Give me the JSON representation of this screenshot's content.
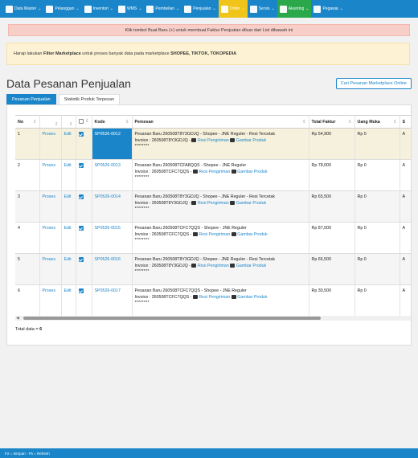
{
  "nav": [
    {
      "label": "Data Master",
      "icon": "list-icon"
    },
    {
      "label": "Pelanggan",
      "icon": "users-icon"
    },
    {
      "label": "Inventori",
      "icon": "truck-icon"
    },
    {
      "label": "WMS",
      "icon": "building-icon"
    },
    {
      "label": "Pembelian",
      "icon": "cart-icon"
    },
    {
      "label": "Penjualan",
      "icon": "document-icon"
    },
    {
      "label": "Order",
      "icon": "fork-knife-icon"
    },
    {
      "label": "Servis",
      "icon": "gears-icon"
    },
    {
      "label": "Akunting",
      "icon": "money-icon"
    },
    {
      "label": "Pegawai",
      "icon": "id-card-icon"
    }
  ],
  "alert_pink": "Klik tombol Buat Baru (+) untuk membuat Faktur Penjualan diluar dari List dibawah ini",
  "alert_yellow": {
    "pre": "Harap lakukan ",
    "bold1": "Filter Marketplace",
    "mid": " untuk proses banyak data pada marketplace ",
    "bold2": "SHOPEE, TIKTOK, TOKOPEDIA"
  },
  "page_title": "Data Pesanan Penjualan",
  "marketplace_button": "Cari Pesanan Marketplace Online",
  "tabs": [
    "Pesanan Penjualan",
    "Statistik Produk Terpesan"
  ],
  "table": {
    "headers": {
      "no": "No",
      "kode": "Kode",
      "pemesan": "Pemesan",
      "total": "Total Faktur",
      "uang_muka": "Uang Muka",
      "s": "S"
    },
    "sort_glyph": "⇕",
    "action_proses": "Proses",
    "action_edit": "Edit",
    "resi_label": "Resi Pengiriman",
    "gambar_label": "Gambar Produk",
    "stars": "********",
    "rows": [
      {
        "no": "1",
        "kode": "SP0526-0012",
        "line1": "Pesanan Baru 260508T8Y3GDJQ - Shopee - JNE Reguler - Resi Tercetak",
        "invoice": "Invoice : 260508T8Y3GDJQ -",
        "total": "Rp 54,900",
        "uang_muka": "Rp 0",
        "s": "A"
      },
      {
        "no": "2",
        "kode": "SP0526-0013",
        "line1": "Pesanan Baru 260508TCFA8QQS - Shopee - JNE Reguler",
        "invoice": "Invoice : 260508TCFC7QQS -",
        "total": "Rp 78,000",
        "uang_muka": "Rp 0",
        "s": "A"
      },
      {
        "no": "3",
        "kode": "SP0526-0014",
        "line1": "Pesanan Baru 260508T8Y3GDJQ - Shopee - JNE Reguler - Resi Tercetak",
        "invoice": "Invoice : 260508T8Y3GDJQ -",
        "total": "Rp 65,500",
        "uang_muka": "Rp 0",
        "s": "A"
      },
      {
        "no": "4",
        "kode": "SP0526-0015",
        "line1": "Pesanan Baru 260508TCFC7QQS - Shopee - JNE Reguler",
        "invoice": "Invoice : 260508TCFC7QQS -",
        "total": "Rp 87,000",
        "uang_muka": "Rp 0",
        "s": "A"
      },
      {
        "no": "5",
        "kode": "SP0526-0016",
        "line1": "Pesanan Baru 260508T8Y3GDJQ - Shopee - JNE Reguler - Resi Tercetak",
        "invoice": "Invoice : 260508T8Y3GDJQ -",
        "total": "Rp 66,500",
        "uang_muka": "Rp 0",
        "s": "A"
      },
      {
        "no": "6",
        "kode": "SP0526-0017",
        "line1": "Pesanan Baru 260508TCFC7QQS - Shopee - JNE Reguler",
        "invoice": "Invoice : 260508TCFC7QQS -",
        "total": "Rp 30,500",
        "uang_muka": "Rp 0",
        "s": "A"
      }
    ]
  },
  "total_label": "Total data = ",
  "total_count": "6",
  "footer": "F2 = Simpan - F5 = Refresh",
  "colors": {
    "primary": "#1a86c9",
    "order": "#f0c419",
    "akunting": "#2aa84a"
  }
}
